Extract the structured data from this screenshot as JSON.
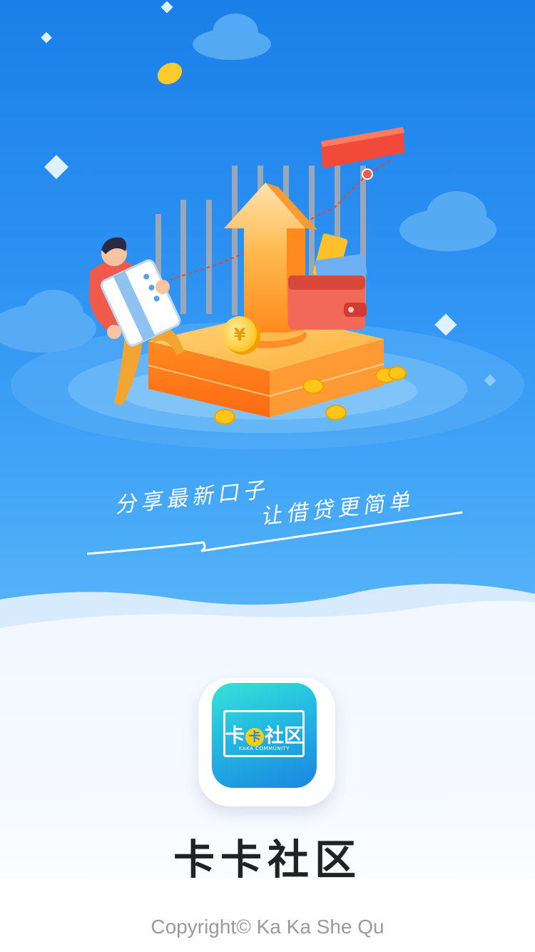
{
  "splash": {
    "slogan_line1": "分享最新口子",
    "slogan_line2": "让借贷更简单",
    "app_name": "卡卡社区",
    "copyright": "Copyright© Ka Ka She Qu"
  },
  "app_icon": {
    "logo_prefix": "卡",
    "logo_coin": "卡",
    "logo_suffix": "社区",
    "logo_subtitle": "KAKA COMMUNITY"
  },
  "icons": [
    "cloud-icon",
    "coin-icon",
    "diamond-sparkle-icon",
    "upward-arrow-icon",
    "wallet-icon",
    "credit-card-icon",
    "person-illustration"
  ],
  "colors": {
    "hero_top": "#1a7fe8",
    "hero_bottom": "#5bb6f8",
    "accent_orange": "#ff7a1a",
    "accent_red": "#f2453a",
    "coin_gold": "#ffc61a",
    "icon_gradient_start": "#35e3d8",
    "icon_gradient_end": "#1b86e0",
    "app_name_text": "#222222",
    "copyright_text": "#9a9a9a"
  }
}
